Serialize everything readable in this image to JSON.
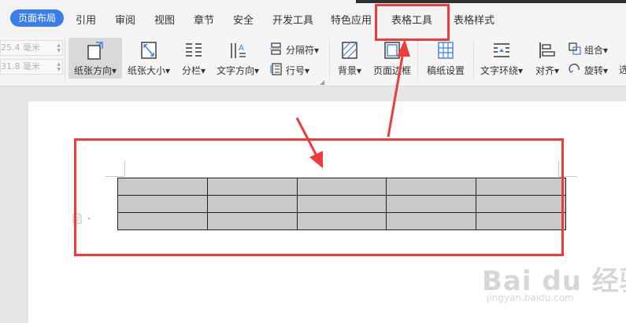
{
  "tabs": [
    {
      "label": "页面布局",
      "active": true
    },
    {
      "label": "引用"
    },
    {
      "label": "审阅"
    },
    {
      "label": "视图"
    },
    {
      "label": "章节"
    },
    {
      "label": "安全"
    },
    {
      "label": "开发工具"
    },
    {
      "label": "特色应用"
    },
    {
      "label": "表格工具"
    },
    {
      "label": "表格样式"
    }
  ],
  "ribbon": {
    "margin_top": "25.4 毫米",
    "margin_bottom": "31.8 毫米",
    "orientation": "纸张方向",
    "paper_size": "纸张大小",
    "columns": "分栏",
    "text_direction": "文字方向",
    "separator": "分隔符",
    "line_number": "行号",
    "background": "背景",
    "page_border": "页面边框",
    "manuscript": "稿纸设置",
    "text_wrap": "文字环绕",
    "align": "对齐",
    "group": "组合",
    "rotate": "旋转",
    "more": "选"
  },
  "watermark": {
    "brand": "Bai du 经验",
    "url": "jingyan.baidu.com"
  },
  "table": {
    "rows": 3,
    "cols": 5
  },
  "colors": {
    "accent": "#3b7de9",
    "annotation_red": "#ee3b3b",
    "table_cell": "#c9c9c9"
  }
}
